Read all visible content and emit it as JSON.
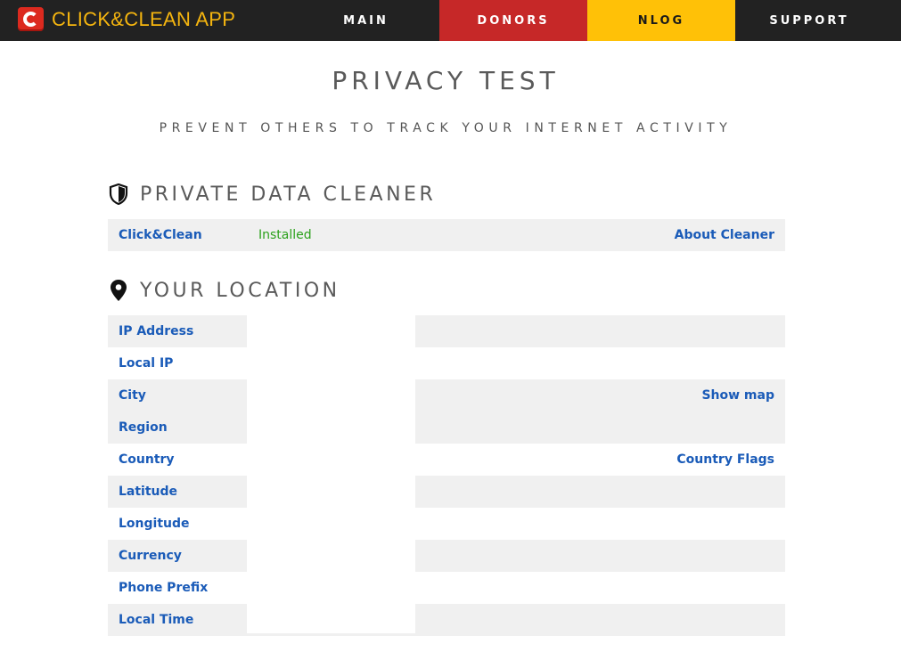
{
  "header": {
    "app_name": "CLICK&CLEAN APP",
    "logo_icon": "c-logo-icon",
    "nav": [
      {
        "label": "MAIN",
        "color": "#222222"
      },
      {
        "label": "DONORS",
        "color": "#c62828"
      },
      {
        "label": "NLOG",
        "color": "#ffc107"
      },
      {
        "label": "SUPPORT",
        "color": "#222222"
      }
    ]
  },
  "page": {
    "title": "PRIVACY TEST",
    "subtitle": "PREVENT OTHERS TO TRACK YOUR INTERNET ACTIVITY"
  },
  "cleaner": {
    "heading": "PRIVATE DATA CLEANER",
    "icon": "shield-icon",
    "name": "Click&Clean",
    "status": "Installed",
    "status_color": "#2ba11b",
    "about_link": "About Cleaner"
  },
  "location": {
    "heading": "YOUR LOCATION",
    "icon": "map-pin-icon",
    "rows": [
      {
        "label": "IP Address",
        "value": ""
      },
      {
        "label": "Local IP",
        "value": ""
      },
      {
        "label": "City",
        "value": ""
      },
      {
        "label": "Region",
        "value": ""
      },
      {
        "label": "Country",
        "value": ""
      },
      {
        "label": "Latitude",
        "value": ""
      },
      {
        "label": "Longitude",
        "value": ""
      },
      {
        "label": "Currency",
        "value": ""
      },
      {
        "label": "Phone Prefix",
        "value": ""
      },
      {
        "label": "Local Time",
        "value": ""
      }
    ],
    "show_map_link": "Show map",
    "country_flags_link": "Country Flags"
  },
  "colors": {
    "link": "#1a5bb8",
    "row_bg": "#f0f0f0",
    "heading": "#5a5a5a"
  }
}
